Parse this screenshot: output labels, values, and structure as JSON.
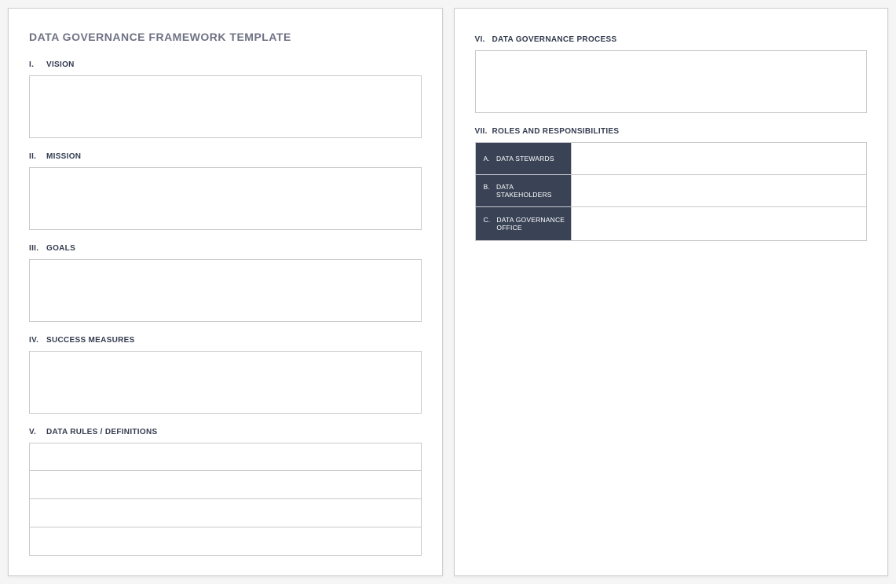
{
  "doc": {
    "title": "DATA GOVERNANCE FRAMEWORK TEMPLATE"
  },
  "page1": {
    "sections": {
      "vision": {
        "roman": "I.",
        "label": "VISION",
        "value": ""
      },
      "mission": {
        "roman": "II.",
        "label": "MISSION",
        "value": ""
      },
      "goals": {
        "roman": "III.",
        "label": "GOALS",
        "value": ""
      },
      "measures": {
        "roman": "IV.",
        "label": "SUCCESS MEASURES",
        "value": ""
      },
      "rules": {
        "roman": "V.",
        "label": "DATA RULES / DEFINITIONS",
        "rows": [
          "",
          "",
          "",
          ""
        ]
      }
    }
  },
  "page2": {
    "sections": {
      "process": {
        "roman": "VI.",
        "label": "DATA GOVERNANCE PROCESS",
        "value": ""
      },
      "roles": {
        "roman": "VII.",
        "label": "ROLES AND RESPONSIBILITIES",
        "items": [
          {
            "letter": "A.",
            "name": "DATA STEWARDS",
            "value": ""
          },
          {
            "letter": "B.",
            "name": "DATA STAKEHOLDERS",
            "value": ""
          },
          {
            "letter": "C.",
            "name": "DATA GOVERNANCE OFFICE",
            "value": ""
          }
        ]
      }
    }
  }
}
